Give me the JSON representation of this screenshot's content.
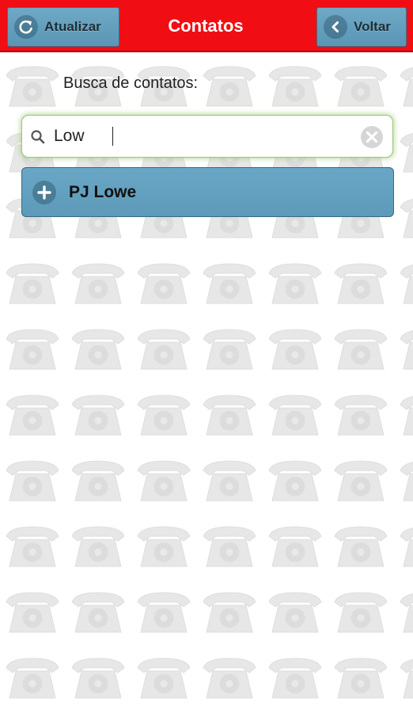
{
  "header": {
    "title": "Contatos",
    "refresh_label": "Atualizar",
    "back_label": "Voltar",
    "color": "#f10d14"
  },
  "search": {
    "label": "Busca de contatos:",
    "value": "Low"
  },
  "results": [
    {
      "name": "PJ Lowe",
      "icon": "plus-icon"
    }
  ],
  "background": {
    "pattern_icon": "telephone-icon"
  }
}
